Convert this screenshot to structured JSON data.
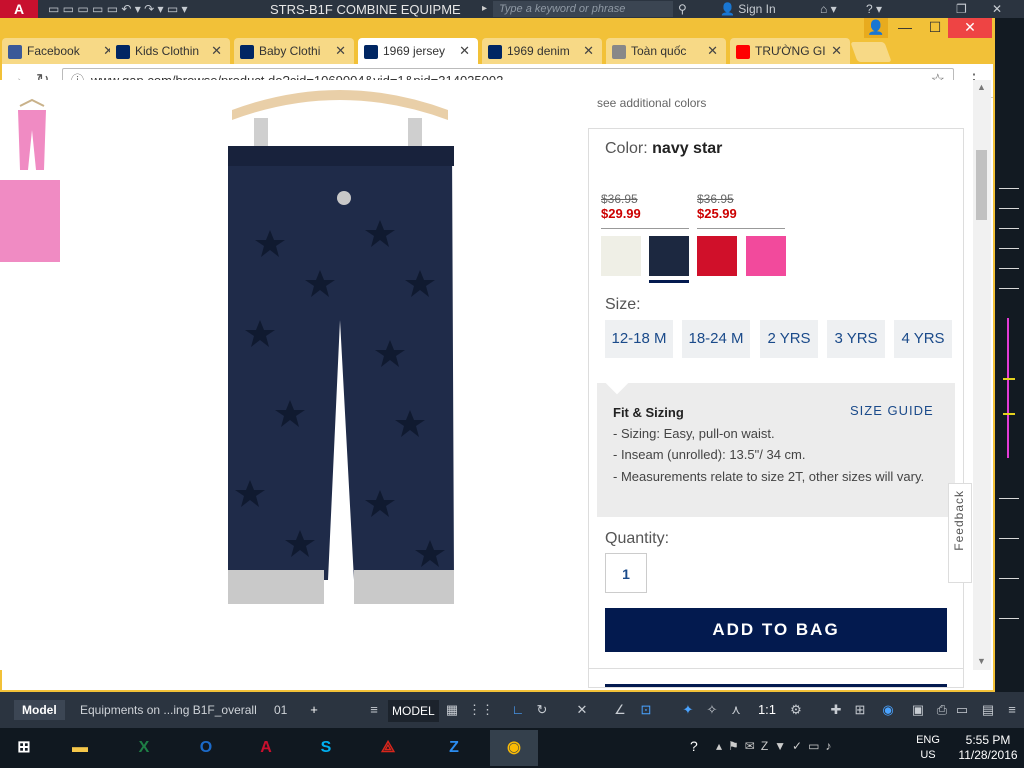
{
  "autocad": {
    "logo": "A",
    "document_title": "STRS-B1F COMBINE EQUIPME",
    "search_placeholder": "Type a keyword or phrase",
    "sign_in": "Sign In",
    "layout_tabs": [
      "Model",
      "Equipments on ...ing B1F_overall",
      "01"
    ],
    "model_label": "MODEL",
    "scale": "1:1"
  },
  "browser": {
    "tabs": [
      {
        "label": "Facebook",
        "favicon_color": "#3b5998",
        "icon": "facebook-icon"
      },
      {
        "label": "Kids Clothin",
        "favicon_color": "#002663",
        "icon": "gap-icon"
      },
      {
        "label": "Baby Clothi",
        "favicon_color": "#002663",
        "icon": "gap-icon"
      },
      {
        "label": "1969 jersey",
        "favicon_color": "#002663",
        "icon": "gap-icon",
        "active": true
      },
      {
        "label": "1969 denim",
        "favicon_color": "#002663",
        "icon": "gap-icon"
      },
      {
        "label": "Toàn quốc",
        "favicon_color": "#888888",
        "icon": "page-icon"
      },
      {
        "label": "TRƯỜNG GI",
        "favicon_color": "#ff0000",
        "icon": "youtube-icon"
      }
    ],
    "url": "www.gap.com/browse/product.do?cid=1069004&vid=1&pid=314025002",
    "profile_icon": "user-icon"
  },
  "product": {
    "see_colors": "see additional colors",
    "color_prefix": "Color:",
    "color_name": "navy star",
    "prices": [
      {
        "old": "$36.95",
        "new": "$29.99"
      },
      {
        "old": "$36.95",
        "new": "$25.99"
      }
    ],
    "swatches": [
      "#efefe6",
      "#1c2840",
      "#d0102a",
      "#f24a9c"
    ],
    "selected_swatch": 1,
    "size_label": "Size:",
    "sizes": [
      "12-18 M",
      "18-24 M",
      "2 YRS",
      "3 YRS",
      "4 YRS"
    ],
    "fit_title": "Fit & Sizing",
    "size_guide": "SIZE GUIDE",
    "fit_lines": [
      "- Sizing: Easy, pull-on waist.",
      "- Inseam (unrolled): 13.5\"/ 34 cm.",
      "- Measurements relate to size 2T, other sizes will vary."
    ],
    "quantity_label": "Quantity:",
    "quantity": "1",
    "add_to_bag": "ADD TO BAG",
    "feedback": "Feedback"
  },
  "taskbar": {
    "apps": [
      "file-explorer",
      "excel",
      "outlook",
      "autocad",
      "skype",
      "acrobat",
      "zalo",
      "chrome"
    ],
    "language_top": "ENG",
    "language_bottom": "US",
    "time": "5:55 PM",
    "date": "11/28/2016"
  },
  "colors": {
    "chrome_frame": "#f2c138",
    "gap_navy": "#031a4f",
    "sale_red": "#cc0000",
    "link_blue": "#1a4a8a"
  }
}
